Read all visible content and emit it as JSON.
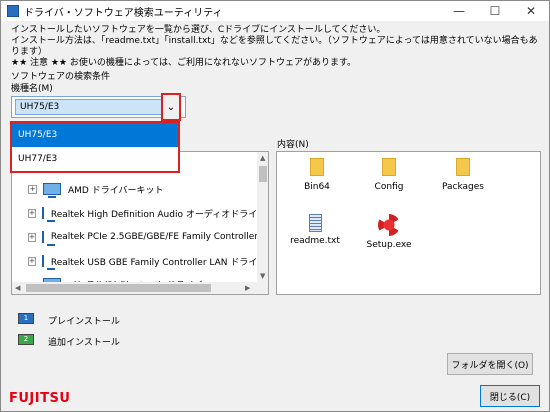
{
  "window": {
    "title": "ドライバ・ソフトウェア検索ユーティリティ",
    "minimize_glyph": "—",
    "maximize_glyph": "☐",
    "close_glyph": "✕"
  },
  "intro": {
    "line1": "インストールしたいソフトウェアを一覧から選び、Cドライブにインストールしてください。",
    "line2": "インストール方法は、「readme.txt」「install.txt」などを参照してください。（ソフトウェアによっては用意されていない場合もあります）",
    "line3": "★★ 注意 ★★ お使いの機種によっては、ご利用になれないソフトウェアがあります。"
  },
  "search": {
    "conditions_label": "ソフトウェアの検索条件",
    "model_label": "機種名(M)",
    "selected_model": "UH75/E3",
    "arrow_glyph": "⌄",
    "options": [
      "UH75/E3",
      "UH77/E3"
    ]
  },
  "tree": {
    "items": [
      {
        "label": "AMD ドライバーキット"
      },
      {
        "label": "Realtek High Definition Audio オーディオドライバー"
      },
      {
        "label": "Realtek PCIe 2.5GBE/GBE/FE Family Controller"
      },
      {
        "label": "Realtek USB GBE Family Controller LAN ドライバー"
      },
      {
        "label": "インテル(R) Bluetooth ドライバー"
      }
    ]
  },
  "content": {
    "label": "内容(N)",
    "files": [
      {
        "name": "Bin64",
        "icon": "folder-icon"
      },
      {
        "name": "Config",
        "icon": "folder-icon"
      },
      {
        "name": "Packages",
        "icon": "folder-icon"
      },
      {
        "name": "readme.txt",
        "icon": "text-file-icon"
      },
      {
        "name": "Setup.exe",
        "icon": "setup-icon"
      }
    ]
  },
  "legend": {
    "preinstall": {
      "num": "1",
      "label": "プレインストール",
      "color": "#2a6fbf"
    },
    "addinstall": {
      "num": "2",
      "label": "追加インストール",
      "color": "#3aa84a"
    }
  },
  "buttons": {
    "open_folder": "フォルダを開く(O)",
    "close": "閉じる(C)"
  },
  "brand": {
    "logo_text": "FUJITSU",
    "logo_color": "#e60012"
  }
}
